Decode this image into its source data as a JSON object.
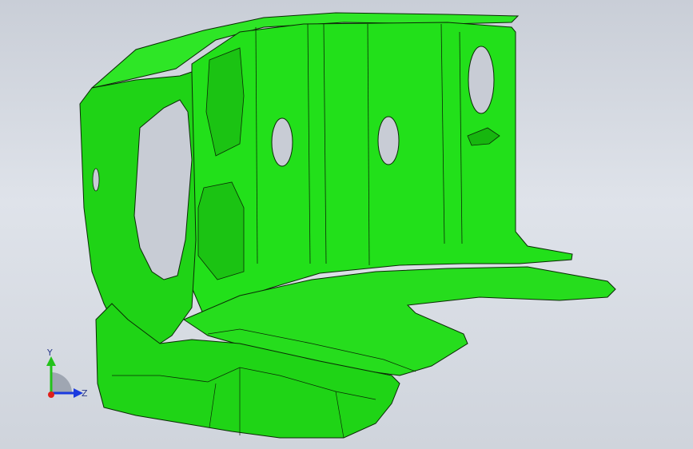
{
  "viewport": {
    "background_top": "#c9ced7",
    "background_bottom": "#cfd4dc"
  },
  "part": {
    "fill_color": "#22e01a",
    "shade_color": "#14b80e",
    "edge_color": "#0a2a05"
  },
  "triad": {
    "y_label": "Y",
    "z_label": "Z",
    "y_color": "#22c21a",
    "z_color": "#1a3adf",
    "origin_color": "#e0201a"
  }
}
